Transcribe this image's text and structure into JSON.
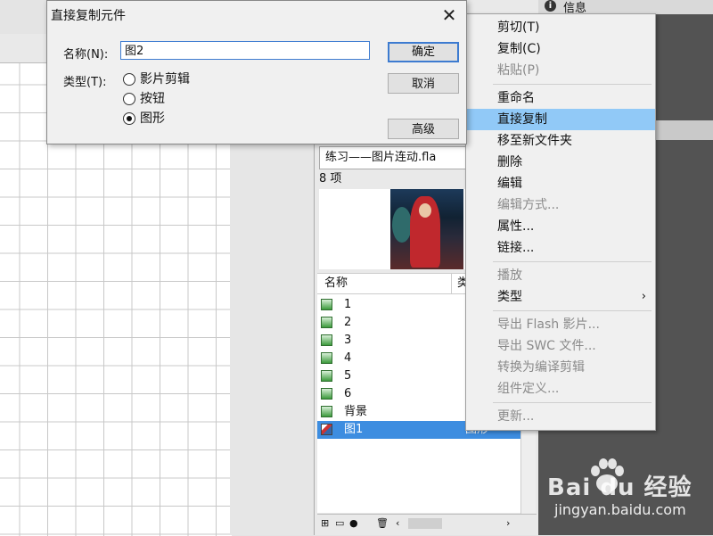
{
  "dialog": {
    "title": "直接复制元件",
    "name_label": "名称(N):",
    "name_value": "图2",
    "type_label": "类型(T):",
    "type_options": [
      {
        "label": "影片剪辑",
        "selected": false
      },
      {
        "label": "按钮",
        "selected": false
      },
      {
        "label": "图形",
        "selected": true
      }
    ],
    "ok_label": "确定",
    "cancel_label": "取消",
    "advanced_label": "高级"
  },
  "info_panel": {
    "tab_label": "信息"
  },
  "library": {
    "file_name": "练习——图片连动.fla",
    "item_count": "8 项",
    "column_name": "名称",
    "column_type": "类",
    "items": [
      {
        "name": "1",
        "icon": "graphic-symbol-icon"
      },
      {
        "name": "2",
        "icon": "graphic-symbol-icon"
      },
      {
        "name": "3",
        "icon": "graphic-symbol-icon"
      },
      {
        "name": "4",
        "icon": "graphic-symbol-icon"
      },
      {
        "name": "5",
        "icon": "graphic-symbol-icon"
      },
      {
        "name": "6",
        "icon": "graphic-symbol-icon"
      },
      {
        "name": "背景",
        "icon": "graphic-symbol-icon"
      },
      {
        "name": "图1",
        "icon": "movie-clip-icon",
        "type": "图形",
        "selected": true
      }
    ]
  },
  "context_menu": {
    "items": [
      {
        "label": "剪切(T)",
        "disabled": false
      },
      {
        "label": "复制(C)",
        "disabled": false
      },
      {
        "label": "粘贴(P)",
        "disabled": true
      },
      {
        "label": "重命名",
        "disabled": false
      },
      {
        "label": "直接复制",
        "disabled": false,
        "highlighted": true
      },
      {
        "label": "移至新文件夹",
        "disabled": false
      },
      {
        "label": "删除",
        "disabled": false
      },
      {
        "label": "编辑",
        "disabled": false
      },
      {
        "label": "编辑方式...",
        "disabled": true
      },
      {
        "label": "属性...",
        "disabled": false
      },
      {
        "label": "链接...",
        "disabled": false
      },
      {
        "label": "播放",
        "disabled": true
      },
      {
        "label": "类型",
        "disabled": false,
        "submenu": true
      },
      {
        "label": "导出 Flash 影片...",
        "disabled": true
      },
      {
        "label": "导出 SWC 文件...",
        "disabled": true
      },
      {
        "label": "转换为编译剪辑",
        "disabled": true
      },
      {
        "label": "组件定义...",
        "disabled": true
      },
      {
        "label": "更新...",
        "disabled": true
      }
    ]
  },
  "watermark": {
    "logo": "Bai du 经验",
    "url": "jingyan.baidu.com"
  },
  "colors": {
    "selection": "#3d8de0",
    "menu_highlight": "#91c9f7",
    "dark_panel": "#535353"
  }
}
